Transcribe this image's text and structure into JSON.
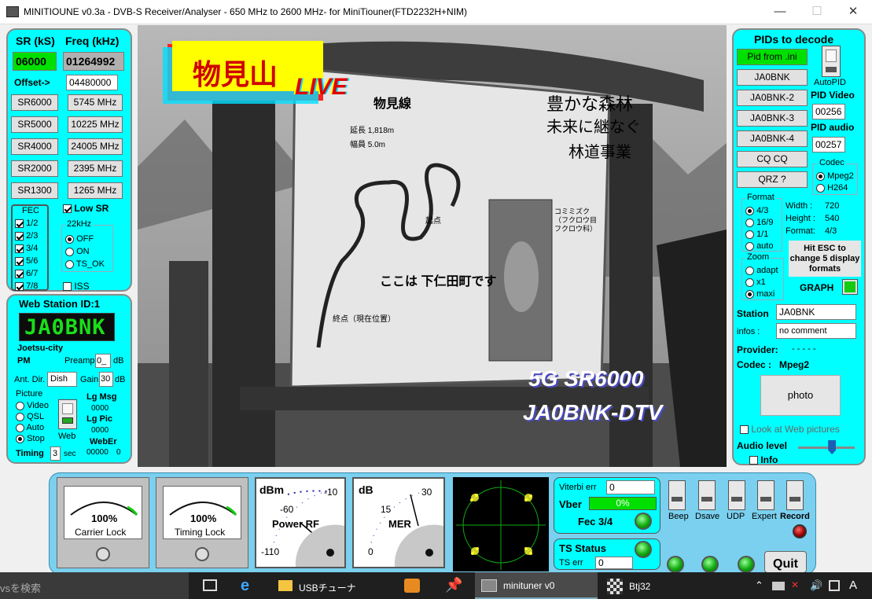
{
  "window": {
    "title": "MINITIOUNE v0.3a - DVB-S Receiver/Analyser - 650 MHz to 2600 MHz- for MiniTiouner(FTD2232H+NIM)",
    "minimize": "—",
    "maximize": "☐",
    "close": "✕"
  },
  "left": {
    "sr_header": "SR (kS)",
    "freq_header": "Freq (kHz)",
    "sr_value": "06000",
    "freq_value": "01264992",
    "offset_label": "Offset->",
    "offset_value": "04480000",
    "sr_buttons": [
      "SR6000",
      "SR5000",
      "SR4000",
      "SR2000",
      "SR1300"
    ],
    "freq_buttons": [
      "5745 MHz",
      "10225 MHz",
      "24005 MHz",
      "2395 MHz",
      "1265 MHz"
    ],
    "fec_title": "FEC",
    "fec_items": [
      "1/2",
      "2/3",
      "3/4",
      "5/6",
      "6/7",
      "7/8"
    ],
    "low_sr": "Low SR",
    "khz_title": "22kHz",
    "khz_options": [
      "OFF",
      "ON",
      "TS_OK"
    ],
    "iss": "ISS"
  },
  "web": {
    "title": "Web Station ID:1",
    "callsign": "JA0BNK",
    "city": "Joetsu-city",
    "pm": "PM",
    "preamp_label": "Preamp",
    "preamp_value": "0_",
    "preamp_unit": "dB",
    "ant_label": "Ant. Dir.",
    "ant_value": "Dish",
    "gain_label": "Gain",
    "gain_value": "30",
    "gain_unit": "dB",
    "picture_title": "Picture",
    "picture_options": [
      "Video",
      "QSL",
      "Auto",
      "Stop"
    ],
    "web_label": "Web",
    "lg_msg": "Lg Msg",
    "lg_msg_val": "0000",
    "lg_pic": "Lg Pic",
    "lg_pic_val": "0000",
    "weberr": "WebEr",
    "weberr_val": "00000",
    "weberr_val2": "0",
    "timing": "Timing",
    "timing_value": "3",
    "timing_unit": "sec"
  },
  "video": {
    "logo_text": "物見山",
    "logo_live": "LIVE",
    "overlay1": "5G SR6000",
    "overlay2": "JA0BNK-DTV",
    "sign_title": "豊かな森林",
    "sign_line2": "未来に継なぐ",
    "sign_line3": "林道事業",
    "sign_route": "物見線",
    "sign_place": "ここは 下仁田町です",
    "sign_start": "起点",
    "sign_end": "終点（現在位置）",
    "sign_owl": "コミミズク（フクロウ目フクロウ科）",
    "sign_length": "延長 1,818m",
    "sign_width": "幅員 5.0m"
  },
  "right": {
    "title": "PIDs to decode",
    "pid_ini": "Pid from .ini",
    "station_buttons": [
      "JA0BNK",
      "JA0BNK-2",
      "JA0BNK-3",
      "JA0BNK-4",
      "CQ CQ",
      "QRZ ?"
    ],
    "autopid": "AutoPID",
    "pid_video_label": "PID Video",
    "pid_video": "00256",
    "pid_audio_label": "PID audio",
    "pid_audio": "00257",
    "codec_title": "Codec",
    "codec_options": [
      "Mpeg2",
      "H264"
    ],
    "format_title": "Format",
    "format_options": [
      "4/3",
      "16/9",
      "1/1",
      "auto"
    ],
    "width_label": "Width :",
    "width_val": "720",
    "height_label": "Height :",
    "height_val": "540",
    "format_label": "Format:",
    "format_val": "4/3",
    "zoom_title": "Zoom",
    "zoom_options": [
      "adapt",
      "x1",
      "maxi"
    ],
    "esc_hint": "Hit ESC to change  5 display formats",
    "graph": "GRAPH",
    "station_label": "Station",
    "station_value": "JA0BNK",
    "infos_label": "infos :",
    "infos_value": "no comment",
    "provider_label": "Provider:",
    "provider_value": "- - - - -",
    "codec_label": "Codec :",
    "codec_value": "Mpeg2",
    "photo": "photo",
    "look_web": "Look at Web pictures",
    "audio_level": "Audio level",
    "info": "Info",
    "audio_level_value": 0.6
  },
  "meters": {
    "carrier_value": "100%",
    "carrier_label": "Carrier Lock",
    "timing_value": "100%",
    "timing_label": "Timing Lock",
    "rf_unit": "dBm",
    "rf_ticks": [
      "-10",
      "-60",
      "-110"
    ],
    "rf_label": "Power RF",
    "mer_unit": "dB",
    "mer_ticks": [
      "30",
      "15",
      "0"
    ],
    "mer_label": "MER"
  },
  "status": {
    "viterbi_label": "Viterbi err",
    "viterbi_value": "0",
    "vber_label": "Vber",
    "vber_value": "0%",
    "fec_label": "Fec 3/4",
    "ts_status": "TS Status",
    "ts_err_label": "TS err",
    "ts_err_value": "0",
    "switches": [
      "Beep",
      "Dsave",
      "UDP",
      "Expert",
      "Record"
    ],
    "quit": "Quit"
  },
  "taskbar": {
    "search": "vsを検索",
    "apps": [
      "USBチューナ",
      "minituner v0",
      "Btj32"
    ],
    "ime": "A"
  },
  "colors": {
    "cyan": "#00ffff",
    "green_field": "#00e000",
    "lcd_bg": "#0c0c0c",
    "lcd_fg": "#19e019"
  }
}
